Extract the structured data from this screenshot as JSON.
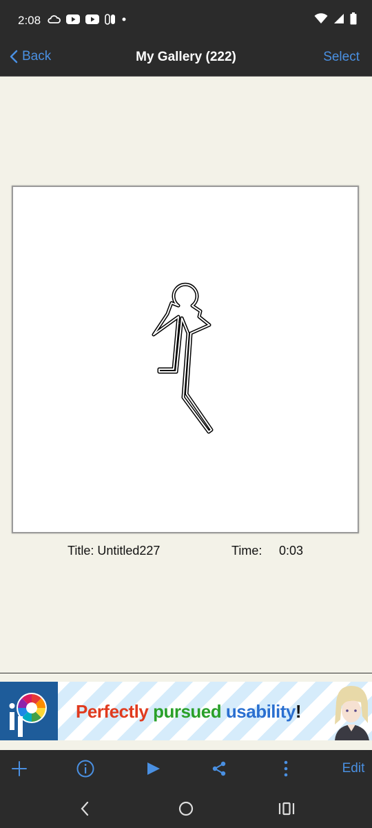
{
  "status_bar": {
    "time": "2:08",
    "icons_left": [
      "cloud-icon",
      "youtube-icon",
      "youtube-icon",
      "switch-icon",
      "dot-icon"
    ],
    "icons_right": [
      "wifi-icon",
      "signal-icon",
      "battery-icon"
    ]
  },
  "nav": {
    "back_label": "Back",
    "title": "My Gallery (222)",
    "select_label": "Select"
  },
  "artwork": {
    "title_text": "Title: Untitled227",
    "time_label": "Time:",
    "time_value": "0:03"
  },
  "ad": {
    "words": [
      "Perfectly",
      "pursued",
      "usability",
      "!"
    ],
    "colors": [
      "#e03a1e",
      "#2aa02a",
      "#2a6fd0",
      "#111111"
    ]
  },
  "toolbar": {
    "buttons": [
      "add-icon",
      "info-icon",
      "play-icon",
      "share-icon",
      "more-icon"
    ],
    "edit_label": "Edit",
    "accent": "#4a90e2"
  },
  "system_nav": [
    "back-icon",
    "home-icon",
    "recents-icon"
  ]
}
